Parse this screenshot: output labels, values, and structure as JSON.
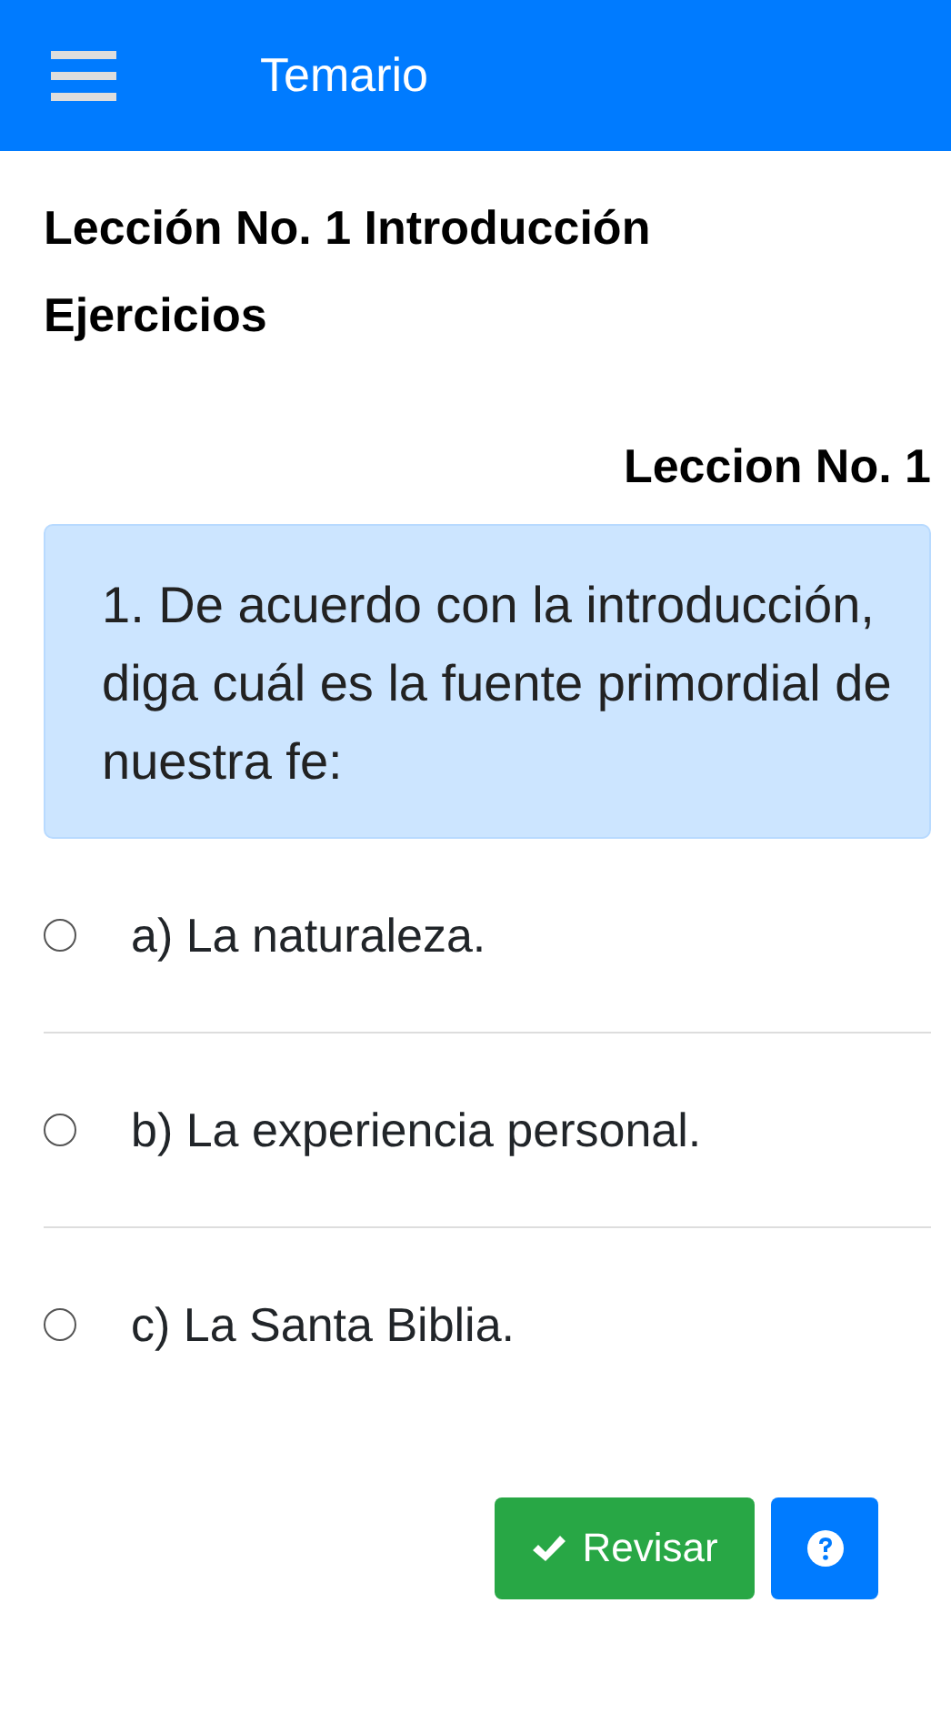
{
  "header": {
    "title": "Temario"
  },
  "lesson_title": "Lección No. 1 Introducción",
  "section_title": "Ejercicios",
  "lesson_label": "Leccion No. 1",
  "question": "1. De acuerdo con la introducción, diga cuál es la fuente primordial de nuestra fe:",
  "options": [
    {
      "label": "a) La naturaleza.",
      "selected": false
    },
    {
      "label": "b) La experiencia personal.",
      "selected": false
    },
    {
      "label": "c) La Santa Biblia.",
      "selected": false
    }
  ],
  "buttons": {
    "check": "Revisar"
  }
}
